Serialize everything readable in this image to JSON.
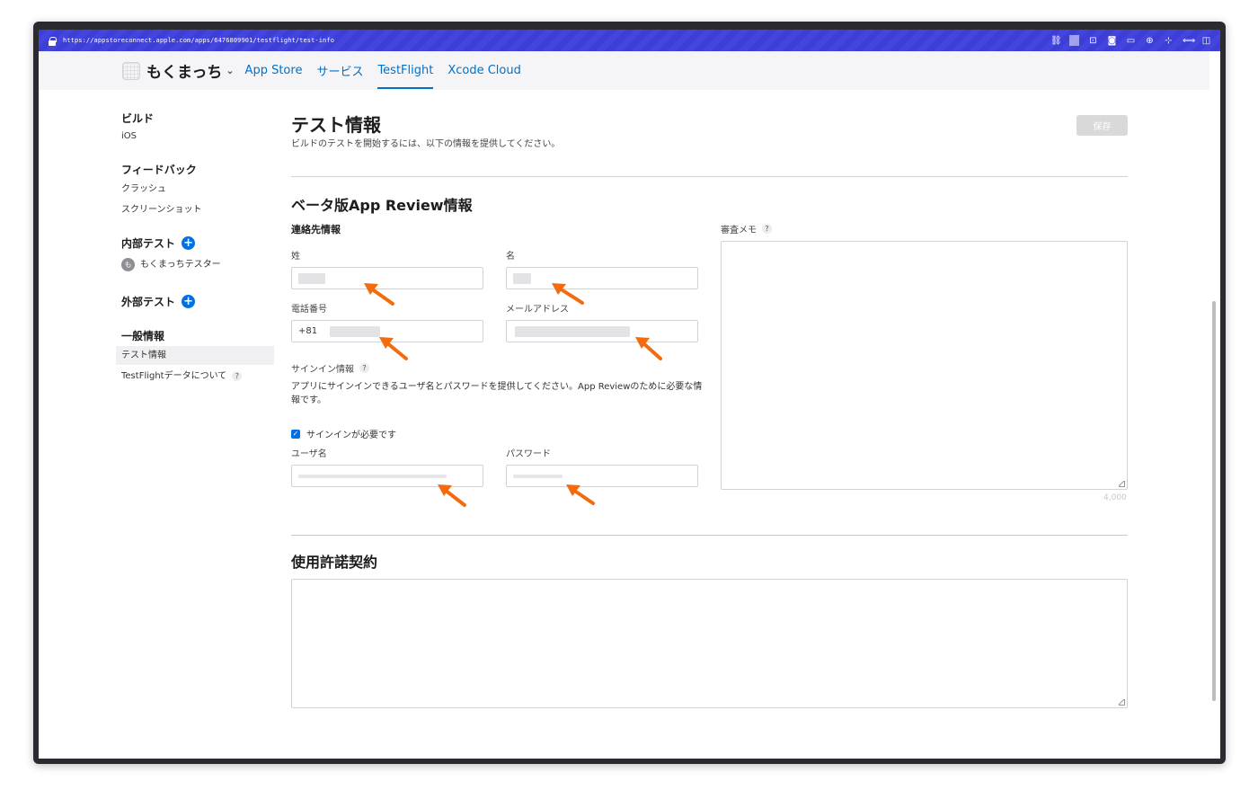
{
  "browser": {
    "url": "https://appstoreconnect.apple.com/apps/6476809901/testflight/test-info"
  },
  "topnav": {
    "app_name": "もくまっち",
    "tabs": [
      {
        "label": "App Store",
        "active": false
      },
      {
        "label": "サービス",
        "active": false
      },
      {
        "label": "TestFlight",
        "active": true
      },
      {
        "label": "Xcode Cloud",
        "active": false
      }
    ]
  },
  "sidebar": {
    "build_head": "ビルド",
    "build_ios": "iOS",
    "feedback_head": "フィードバック",
    "feedback_crash": "クラッシュ",
    "feedback_screenshot": "スクリーンショット",
    "internal_head": "内部テスト",
    "internal_group": "もくまっちテスター",
    "internal_group_initial": "も",
    "external_head": "外部テスト",
    "general_head": "一般情報",
    "general_testinfo": "テスト情報",
    "general_about": "TestFlightデータについて"
  },
  "main": {
    "title": "テスト情報",
    "subtitle": "ビルドのテストを開始するには、以下の情報を提供してください。",
    "save_label": "保存",
    "beta_review_title": "ベータ版App Review情報",
    "contact_head": "連絡先情報",
    "last_name_label": "姓",
    "first_name_label": "名",
    "phone_label": "電話番号",
    "phone_prefix": "+81",
    "email_label": "メールアドレス",
    "signin_label": "サインイン情報",
    "signin_desc": "アプリにサインインできるユーザ名とパスワードを提供してください。App Reviewのために必要な情報です。",
    "signin_required_label": "サインインが必要です",
    "signin_required_checked": true,
    "username_label": "ユーザ名",
    "password_label": "パスワード",
    "review_notes_label": "審査メモ",
    "review_notes_counter": "4,000",
    "license_title": "使用許諾契約"
  },
  "colors": {
    "accent": "#0070c9",
    "annotation_arrow": "#f26b0f",
    "url_bar": "#3d3ed6"
  }
}
